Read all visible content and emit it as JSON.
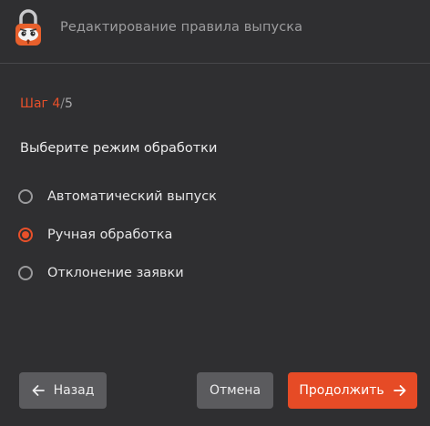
{
  "window": {
    "title": "Редактирование правила выпуска",
    "logo_icon": "padlock-mascot-icon"
  },
  "wizard": {
    "step_prefix": "Шаг",
    "current_step": "4",
    "separator": "/",
    "total_steps": "5",
    "prompt": "Выберите режим обработки"
  },
  "options": [
    {
      "label": "Автоматический выпуск",
      "selected": false
    },
    {
      "label": "Ручная обработка",
      "selected": true
    },
    {
      "label": "Отклонение заявки",
      "selected": false
    }
  ],
  "buttons": {
    "back_label": "Назад",
    "back_icon": "arrow-left-icon",
    "cancel_label": "Отмена",
    "next_label": "Продолжить",
    "next_icon": "arrow-right-icon"
  },
  "colors": {
    "accent": "#e8502a",
    "background": "#2f2f31",
    "secondary_button": "#5b5b5e"
  }
}
